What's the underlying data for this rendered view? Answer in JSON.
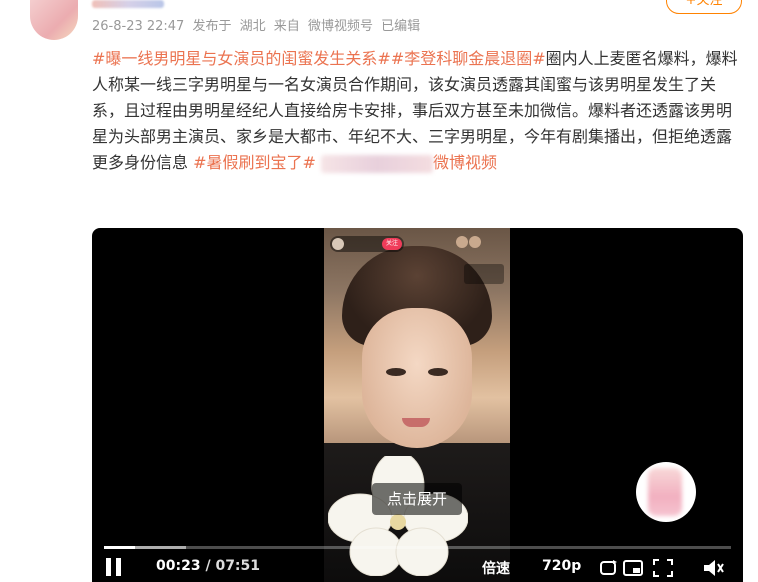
{
  "header": {
    "follow_label": "+关注",
    "meta": {
      "timestamp": "26-8-23 22:47",
      "posted_in_prefix": "发布于",
      "location": "湖北",
      "source_prefix": "来自",
      "source": "微博视频号",
      "edited": "已编辑"
    }
  },
  "post": {
    "topic1": "#曝一线男明星与女演员的闺蜜发生关系#",
    "topic2": "#李登科聊金晨退圈#",
    "body": "圈内人上麦匿名爆料，爆料人称某一线三字男明星与一名女演员合作期间，该女演员透露其闺蜜与该男明星发生了关系，且过程由男明星经纪人直接给房卡安排，事后双方甚至未加微信。爆料者还透露该男明星为头部男主演员、家乡是大都市、年纪不大、三字男明星，今年有剧集播出，但拒绝透露更多身份信息",
    "topic3": "#暑假刷到宝了#",
    "tail_link": "微博视频"
  },
  "video": {
    "expand_label": "点击展开",
    "current_time": "00:23",
    "time_separator": "/",
    "duration": "07:51",
    "rate_label": "倍速",
    "quality_label": "720p",
    "progress_fraction": 0.05,
    "buffered_fraction": 0.13,
    "overlay": {
      "follow_tag": "关注"
    }
  }
}
